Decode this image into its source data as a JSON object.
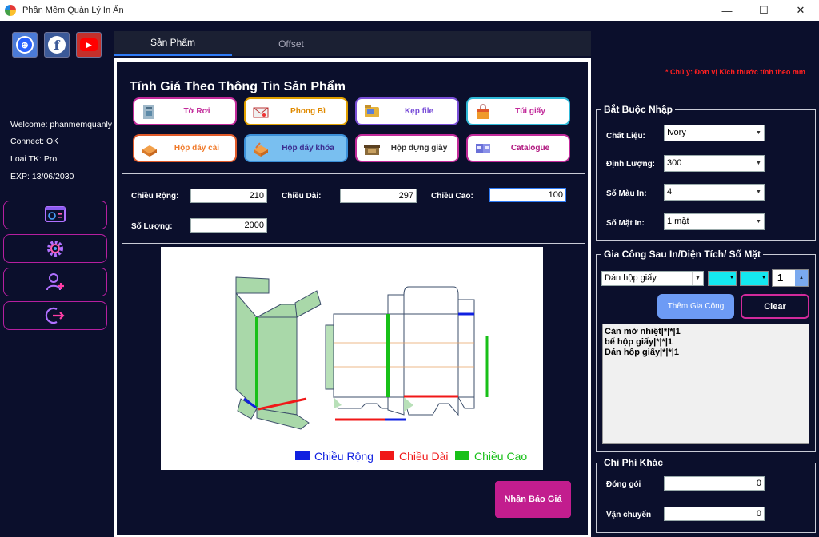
{
  "window": {
    "title": "Phần Mềm Quản Lý In Ấn",
    "minimize": "—",
    "maximize": "☐",
    "close": "✕"
  },
  "sidebar": {
    "welcome": "Welcome: phanmemquanly",
    "connect": "Connect: OK",
    "account_type": "Loại TK: Pro",
    "expiry": "EXP:  13/06/2030"
  },
  "tabs": [
    {
      "label": "Sản Phẩm"
    },
    {
      "label": "Offset"
    }
  ],
  "main": {
    "title": "Tính Giá Theo Thông Tin Sản Phẩm",
    "products": [
      {
        "label": "Tờ Rơi",
        "color": "#c22a9a"
      },
      {
        "label": "Phong Bì",
        "color": "#e08a00"
      },
      {
        "label": "Kẹp file",
        "color": "#7a4fd8"
      },
      {
        "label": "Túi giấy",
        "color": "#c22a9a"
      },
      {
        "label": "Hộp đáy cài",
        "color": "#f07a2a"
      },
      {
        "label": "Hộp đáy khóa",
        "color": "#3a2b8f"
      },
      {
        "label": "Hộp đựng giày",
        "color": "#333333"
      },
      {
        "label": "Catalogue",
        "color": "#b0157e"
      }
    ],
    "width_label": "Chiều Rộng:",
    "width_value": "210",
    "length_label": "Chiều Dài:",
    "length_value": "297",
    "height_label": "Chiều Cao:",
    "height_value": "100",
    "qty_label": "Số Lượng:",
    "qty_value": "2000",
    "legend": {
      "width": "Chiều Rộng",
      "length": "Chiều Dài",
      "height": "Chiều Cao"
    },
    "quote_button": "Nhận Báo Giá"
  },
  "right": {
    "note": "* Chú ý: Đơn vị Kích thước tính theo mm",
    "required": {
      "title": "Bắt Buộc Nhập",
      "material_label": "Chất Liệu:",
      "material_value": "Ivory",
      "weight_label": "Định Lượng:",
      "weight_value": "300",
      "colors_label": "Số Màu In:",
      "colors_value": "4",
      "sides_label": "Số Mặt In:",
      "sides_value": "1 mặt"
    },
    "postpress": {
      "title": "Gia Công Sau In/Diện Tích/ Số Mặt",
      "process_value": "Dán hộp giấy",
      "count_value": "1",
      "add_button": "Thêm Gia Công",
      "clear_button": "Clear",
      "items": [
        "Cán mờ nhiệt|*|*|1",
        "bế hộp giấy|*|*|1",
        "Dán hộp giấy|*|*|1"
      ]
    },
    "other": {
      "title": "Chi Phí Khác",
      "packing_label": "Đóng gói",
      "packing_value": "0",
      "shipping_label": "Vận chuyển",
      "shipping_value": "0"
    }
  },
  "colors": {
    "background": "#0b0f2c",
    "accent_magenta": "#c21d8e",
    "accent_blue": "#2f7bf6",
    "legend_blue": "#1020e0",
    "legend_red": "#f01818",
    "legend_green": "#18c018"
  }
}
